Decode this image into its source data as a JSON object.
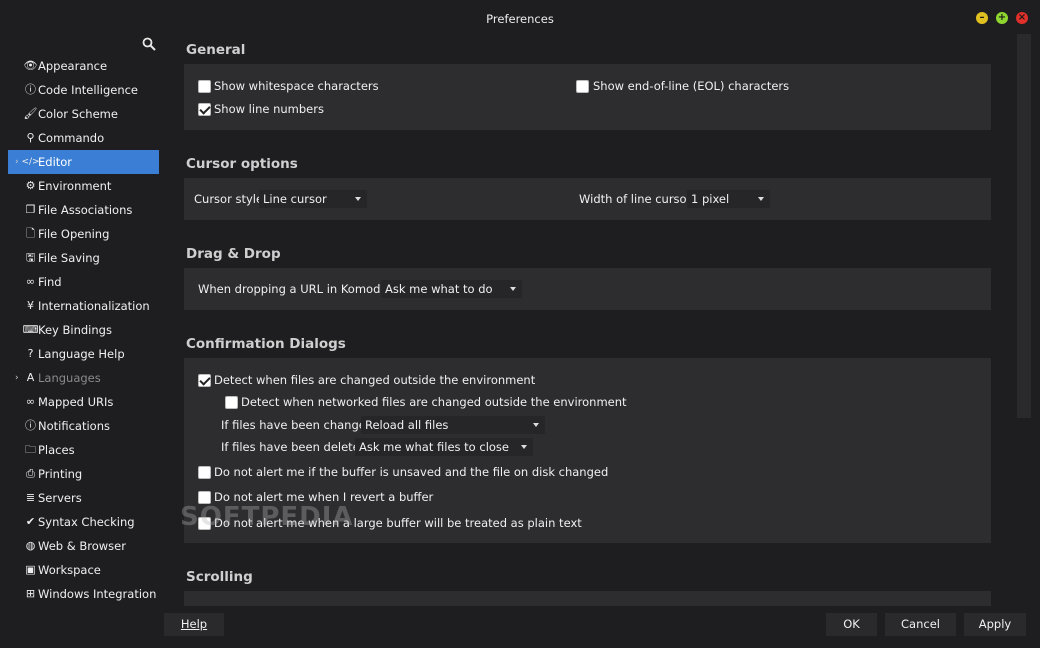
{
  "window": {
    "title": "Preferences",
    "colors": {
      "minimize": "#e0c020",
      "maximize": "#8fd630",
      "close": "#e0302a",
      "accent": "#3a7fd5"
    }
  },
  "sidebar": {
    "search_placeholder": "",
    "items": [
      {
        "label": "Appearance",
        "icon": "eye-icon"
      },
      {
        "label": "Code Intelligence",
        "icon": "info-icon"
      },
      {
        "label": "Color Scheme",
        "icon": "brush-icon"
      },
      {
        "label": "Commando",
        "icon": "pin-icon"
      },
      {
        "label": "Editor",
        "icon": "code-icon",
        "selected": true,
        "expandable": true
      },
      {
        "label": "Environment",
        "icon": "gear-icon"
      },
      {
        "label": "File Associations",
        "icon": "copy-icon"
      },
      {
        "label": "File Opening",
        "icon": "file-icon"
      },
      {
        "label": "File Saving",
        "icon": "save-icon"
      },
      {
        "label": "Find",
        "icon": "binoculars-icon"
      },
      {
        "label": "Internationalization",
        "icon": "yen-icon"
      },
      {
        "label": "Key Bindings",
        "icon": "keyboard-icon"
      },
      {
        "label": "Language Help",
        "icon": "help-icon"
      },
      {
        "label": "Languages",
        "icon": "language-icon",
        "dim": true,
        "expandable": true
      },
      {
        "label": "Mapped URIs",
        "icon": "link-icon"
      },
      {
        "label": "Notifications",
        "icon": "info-icon"
      },
      {
        "label": "Places",
        "icon": "folder-icon"
      },
      {
        "label": "Printing",
        "icon": "printer-icon"
      },
      {
        "label": "Servers",
        "icon": "server-icon"
      },
      {
        "label": "Syntax Checking",
        "icon": "check-circle-icon"
      },
      {
        "label": "Web & Browser",
        "icon": "globe-icon"
      },
      {
        "label": "Workspace",
        "icon": "briefcase-icon"
      },
      {
        "label": "Windows Integration",
        "icon": "windows-icon"
      }
    ]
  },
  "general": {
    "title": "General",
    "show_whitespace": {
      "label": "Show whitespace characters",
      "checked": false
    },
    "show_eol": {
      "label": "Show end-of-line (EOL) characters",
      "checked": false
    },
    "show_line_numbers": {
      "label": "Show line numbers",
      "checked": true
    }
  },
  "cursor": {
    "title": "Cursor options",
    "style_label": "Cursor style:",
    "style_value": "Line cursor",
    "width_label": "Width of line cursor:",
    "width_value": "1 pixel"
  },
  "dragdrop": {
    "title": "Drag & Drop",
    "url_label": "When dropping a URL in Komodo:",
    "url_value": "Ask me what to do"
  },
  "confirm": {
    "title": "Confirmation Dialogs",
    "detect_changed": {
      "label": "Detect when files are changed outside the environment",
      "checked": true
    },
    "detect_networked": {
      "label": "Detect when networked files are changed outside the environment",
      "checked": false
    },
    "changed_label": "If files have been changed:",
    "changed_value": "Reload all files",
    "deleted_label": "If files have been deleted:",
    "deleted_value": "Ask me what files to close",
    "no_alert_unsaved": {
      "label": "Do not alert me if the buffer is unsaved and the file on disk changed",
      "checked": false
    },
    "no_alert_revert": {
      "label": "Do not alert me when I revert a buffer",
      "checked": false
    },
    "no_alert_large": {
      "label": "Do not alert me when a large buffer will be treated as plain text",
      "checked": false
    }
  },
  "scrolling": {
    "title": "Scrolling"
  },
  "footer": {
    "help": "Help",
    "ok": "OK",
    "cancel": "Cancel",
    "apply": "Apply"
  },
  "watermark": "SOFTPEDIA"
}
